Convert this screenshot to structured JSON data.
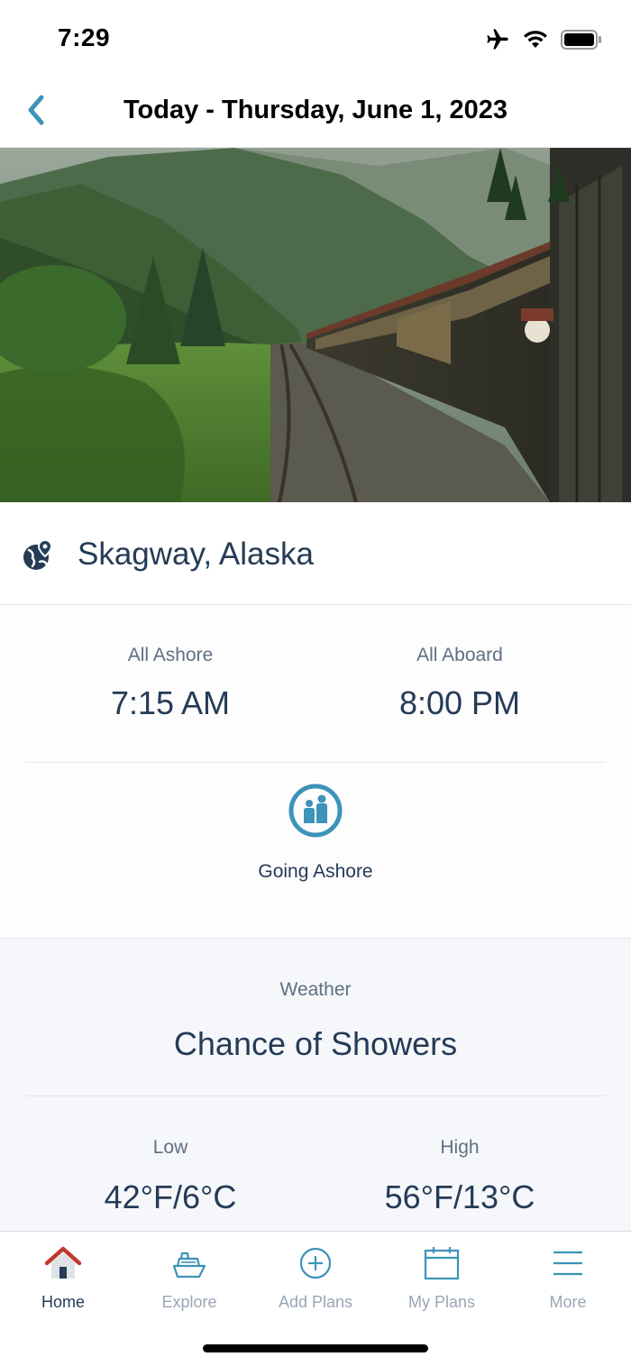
{
  "status_bar": {
    "time": "7:29",
    "icons": [
      "airplane-icon",
      "wifi-icon",
      "battery-icon"
    ]
  },
  "header": {
    "title": "Today - Thursday, June 1, 2023",
    "back_icon": "chevron-left-icon"
  },
  "hero": {
    "description_icon": "hero-photo"
  },
  "port": {
    "name": "Skagway, Alaska",
    "icon": "globe-pin-icon"
  },
  "times": {
    "all_ashore_label": "All Ashore",
    "all_ashore_value": "7:15 AM",
    "all_aboard_label": "All Aboard",
    "all_aboard_value": "8:00 PM"
  },
  "going_ashore": {
    "label": "Going Ashore",
    "icon": "family-icon"
  },
  "weather": {
    "label": "Weather",
    "value": "Chance of Showers",
    "low_label": "Low",
    "low_value": "42°F/6°C",
    "high_label": "High",
    "high_value": "56°F/13°C"
  },
  "tabs": [
    {
      "label": "Home",
      "icon": "home-icon",
      "active": true
    },
    {
      "label": "Explore",
      "icon": "ship-icon",
      "active": false
    },
    {
      "label": "Add Plans",
      "icon": "plus-circle-icon",
      "active": false
    },
    {
      "label": "My Plans",
      "icon": "calendar-icon",
      "active": false
    },
    {
      "label": "More",
      "icon": "menu-icon",
      "active": false
    }
  ],
  "colors": {
    "accent": "#3d93b8",
    "text": "#253b56",
    "muted": "#5f6f82",
    "home_roof": "#c0392b"
  }
}
